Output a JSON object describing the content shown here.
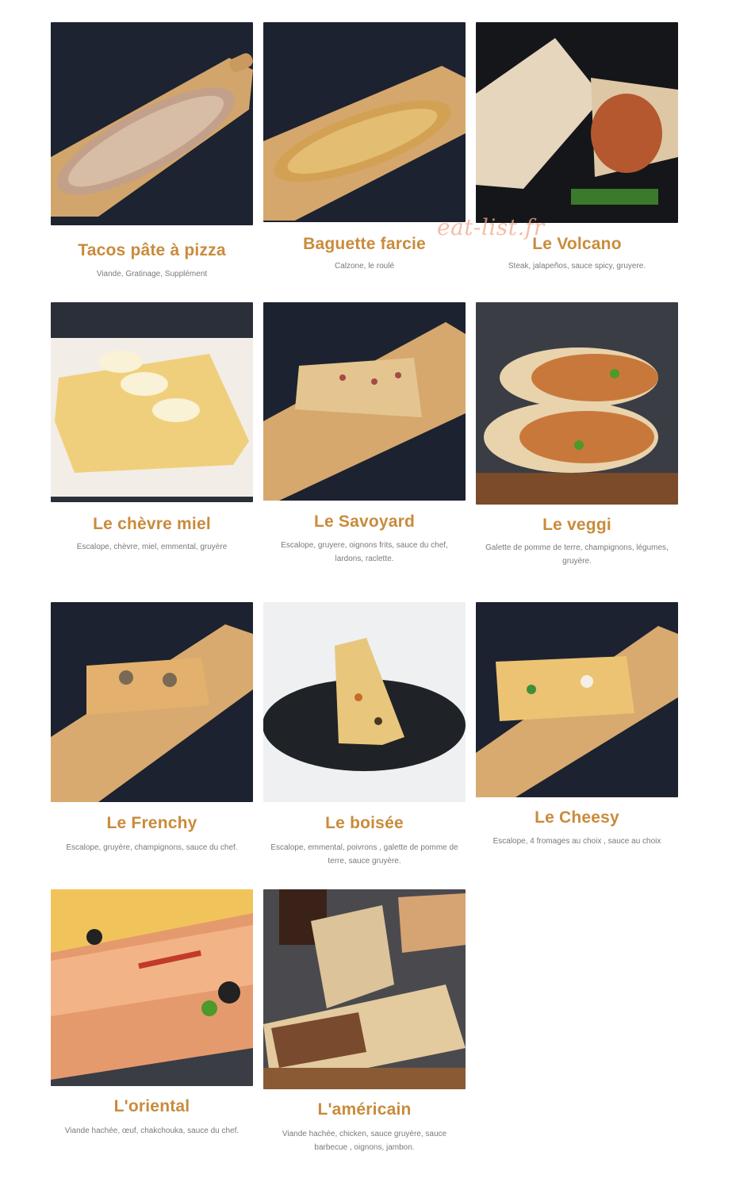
{
  "watermark": "eat-list.fr",
  "items": [
    {
      "title": "Tacos pâte à pizza",
      "desc": "Viande, Gratinage, Supplément"
    },
    {
      "title": "Baguette farcie",
      "desc": "Calzone, le roulé"
    },
    {
      "title": "Le Volcano",
      "desc": "Steak, jalapeños, sauce spicy, gruyere."
    },
    {
      "title": "Le chèvre miel",
      "desc": "Escalope, chèvre, miel, emmental, gruyère"
    },
    {
      "title": "Le Savoyard",
      "desc": "Escalope, gruyere, oignons frits, sauce du chef, lardons, raclette."
    },
    {
      "title": "Le veggi",
      "desc": "Galette de pomme de terre, champignons, légumes, gruyère."
    },
    {
      "title": "Le Frenchy",
      "desc": "Escalope, gruyère, champignons, sauce du chef."
    },
    {
      "title": "Le boisée",
      "desc": "Escalope, emmental, poivrons , galette de pomme de terre, sauce gruyère."
    },
    {
      "title": "Le Cheesy",
      "desc": "Escalope, 4 fromages au choix , sauce au choix"
    },
    {
      "title": "L'oriental",
      "desc": "Viande hachée, œuf, chakchouka, sauce du chef."
    },
    {
      "title": "L'américain",
      "desc": "Viande hachée, chicken, sauce gruyère, sauce barbecue , oignons, jambon."
    }
  ]
}
